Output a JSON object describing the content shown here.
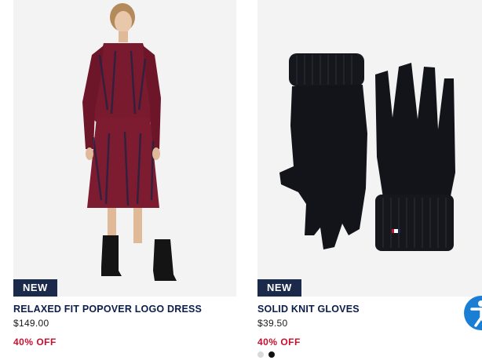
{
  "products": [
    {
      "badge": "NEW",
      "name": "RELAXED FIT POPOVER LOGO DRESS",
      "price": "$149.00",
      "discount": "40% OFF",
      "image": "model-in-logo-dress"
    },
    {
      "badge": "NEW",
      "name": "SOLID KNIT GLOVES",
      "price": "$39.50",
      "discount": "40% OFF",
      "image": "black-knit-gloves",
      "swatches": [
        "#d9d9d9",
        "#111111"
      ]
    }
  ],
  "colors": {
    "badge_bg": "#1b2a4a",
    "title": "#0b1e4b",
    "discount": "#c8102e",
    "accessibility": "#1a7fd4"
  },
  "accessibility": {
    "icon": "accessibility-icon"
  }
}
